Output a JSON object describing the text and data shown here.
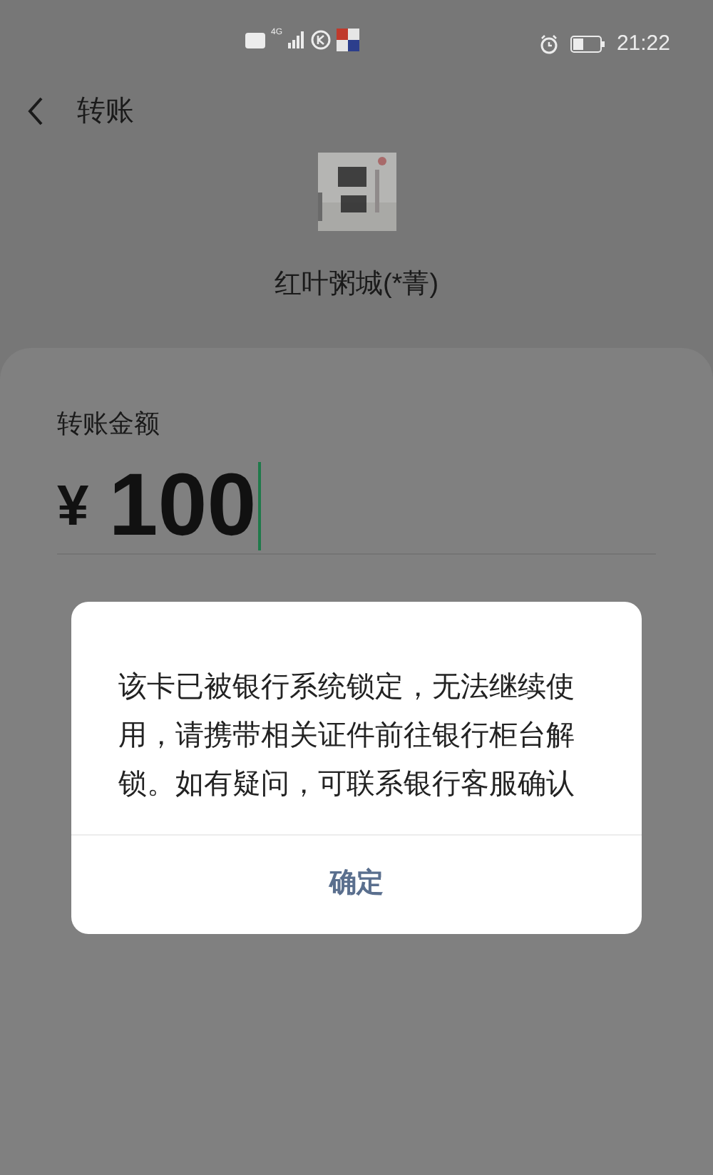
{
  "status_bar": {
    "time": "21:22",
    "network": "4G"
  },
  "header": {
    "title": "转账"
  },
  "payee": {
    "name": "红叶粥城(*菁)"
  },
  "amount_card": {
    "label": "转账金额",
    "currency": "¥",
    "amount": "100"
  },
  "dialog": {
    "message": "该卡已被银行系统锁定，无法继续使用，请携带相关证件前往银行柜台解锁。如有疑问，可联系银行客服确认",
    "button": "确定"
  }
}
